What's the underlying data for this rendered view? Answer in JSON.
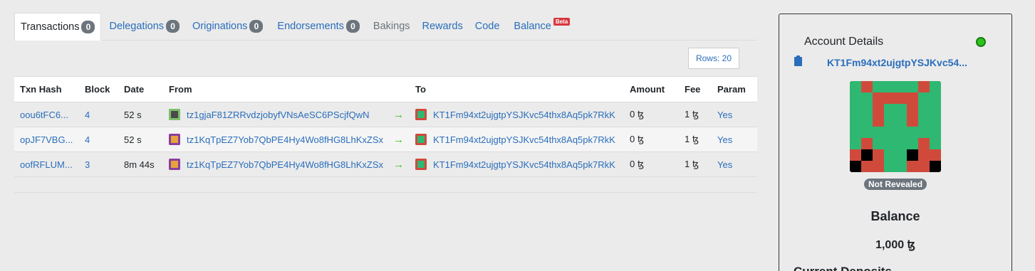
{
  "tabs": [
    {
      "label": "Transactions",
      "count": "0"
    },
    {
      "label": "Delegations",
      "count": "0"
    },
    {
      "label": "Originations",
      "count": "0"
    },
    {
      "label": "Endorsements",
      "count": "0"
    },
    {
      "label": "Bakings"
    },
    {
      "label": "Rewards"
    },
    {
      "label": "Code"
    },
    {
      "label": "Balance",
      "badge": "Beta"
    }
  ],
  "toolbar": {
    "rows_label": "Rows: 20"
  },
  "table": {
    "headers": [
      "Txn Hash",
      "Block",
      "Date",
      "From",
      "To",
      "Amount",
      "Fee",
      "Param"
    ],
    "rows": [
      {
        "hash": "oou6tFC6...",
        "block": "4",
        "date": "52 s",
        "from": "tz1gjaF81ZRRvdzjobyfVNsAeSC6PScjfQwN",
        "to": "KT1Fm94xt2ujgtpYSJKvc54thx8Aq5pk7RkK",
        "amount": "0 ꜩ",
        "fee": "1 ꜩ",
        "param": "Yes"
      },
      {
        "hash": "opJF7VBG...",
        "block": "4",
        "date": "52 s",
        "from": "tz1KqTpEZ7Yob7QbPE4Hy4Wo8fHG8LhKxZSx",
        "to": "KT1Fm94xt2ujgtpYSJKvc54thx8Aq5pk7RkK",
        "amount": "0 ꜩ",
        "fee": "1 ꜩ",
        "param": "Yes"
      },
      {
        "hash": "oofRFLUM...",
        "block": "3",
        "date": "8m 44s",
        "from": "tz1KqTpEZ7Yob7QbPE4Hy4Wo8fHG8LhKxZSx",
        "to": "KT1Fm94xt2ujgtpYSJKvc54thx8Aq5pk7RkK",
        "amount": "0 ꜩ",
        "fee": "1 ꜩ",
        "param": "Yes"
      }
    ]
  },
  "account": {
    "title": "Account Details",
    "address": "KT1Fm94xt2ujgtpYSJKvc54...",
    "reveal_status": "Not Revealed",
    "balance_label": "Balance",
    "balance_value": "1,000 ꜩ",
    "deposits_label": "Current Deposits"
  },
  "colors": {
    "link": "#2a6ebb",
    "status_online": "#28c71a",
    "identicon_red": "#d04a3c",
    "identicon_green": "#2eb872"
  }
}
